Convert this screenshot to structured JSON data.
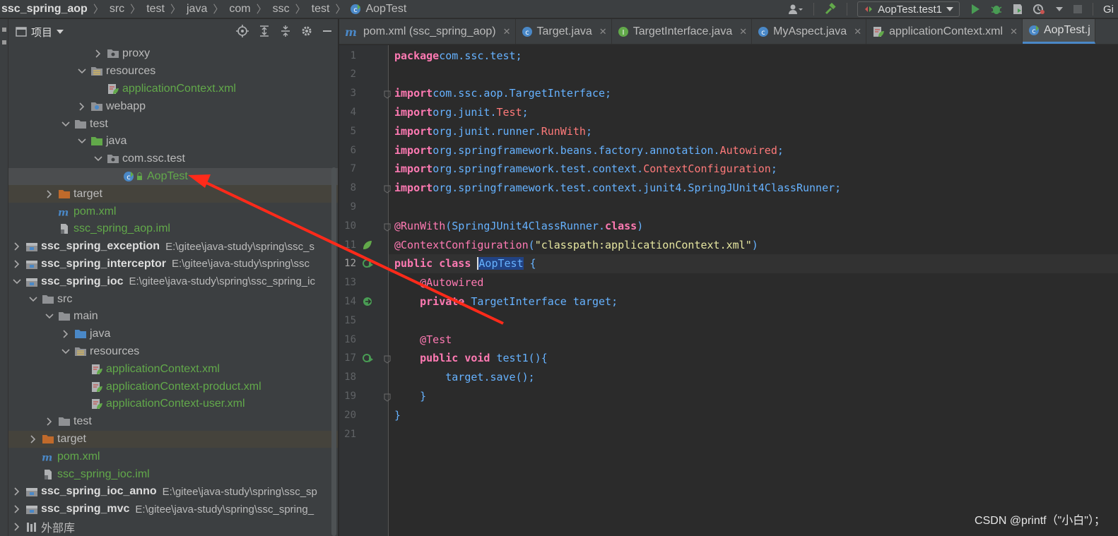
{
  "breadcrumb": {
    "items": [
      "ssc_spring_aop",
      "src",
      "test",
      "java",
      "com",
      "ssc",
      "test",
      "AopTest"
    ]
  },
  "run_config": {
    "label": "AopTest.test1"
  },
  "nav_trailing": "Gi",
  "project_panel": {
    "title": "项目"
  },
  "tree": [
    {
      "label": "proxy",
      "type": "package",
      "indent": 5,
      "arrow": "right"
    },
    {
      "label": "resources",
      "type": "res-folder",
      "indent": 4,
      "arrow": "down"
    },
    {
      "label": "applicationContext.xml",
      "type": "spring-xml",
      "indent": 5,
      "arrow": "",
      "green": true
    },
    {
      "label": "webapp",
      "type": "web-folder",
      "indent": 4,
      "arrow": "right"
    },
    {
      "label": "test",
      "type": "folder",
      "indent": 3,
      "arrow": "down"
    },
    {
      "label": "java",
      "type": "test-src",
      "indent": 4,
      "arrow": "down"
    },
    {
      "label": "com.ssc.test",
      "type": "package",
      "indent": 5,
      "arrow": "down"
    },
    {
      "label": "AopTest",
      "type": "java-class",
      "indent": 6,
      "arrow": "",
      "green": true,
      "selected": true
    },
    {
      "label": "target",
      "type": "target-folder",
      "indent": 2,
      "arrow": "right",
      "tint": true
    },
    {
      "label": "pom.xml",
      "type": "maven",
      "indent": 2,
      "arrow": "",
      "green": true
    },
    {
      "label": "ssc_spring_aop.iml",
      "type": "iml",
      "indent": 2,
      "arrow": "",
      "green": true
    },
    {
      "label": "ssc_spring_exception",
      "type": "module",
      "indent": 0,
      "arrow": "right",
      "bold": true,
      "path": "E:\\gitee\\java-study\\spring\\ssc_s"
    },
    {
      "label": "ssc_spring_interceptor",
      "type": "module",
      "indent": 0,
      "arrow": "right",
      "bold": true,
      "path": "E:\\gitee\\java-study\\spring\\ssc"
    },
    {
      "label": "ssc_spring_ioc",
      "type": "module",
      "indent": 0,
      "arrow": "down",
      "bold": true,
      "path": "E:\\gitee\\java-study\\spring\\ssc_spring_ic"
    },
    {
      "label": "src",
      "type": "folder",
      "indent": 1,
      "arrow": "down"
    },
    {
      "label": "main",
      "type": "folder",
      "indent": 2,
      "arrow": "down"
    },
    {
      "label": "java",
      "type": "src-folder",
      "indent": 3,
      "arrow": "right"
    },
    {
      "label": "resources",
      "type": "res-folder",
      "indent": 3,
      "arrow": "down"
    },
    {
      "label": "applicationContext.xml",
      "type": "spring-xml",
      "indent": 4,
      "arrow": "",
      "green": true
    },
    {
      "label": "applicationContext-product.xml",
      "type": "spring-xml",
      "indent": 4,
      "arrow": "",
      "green": true
    },
    {
      "label": "applicationContext-user.xml",
      "type": "spring-xml",
      "indent": 4,
      "arrow": "",
      "green": true
    },
    {
      "label": "test",
      "type": "folder",
      "indent": 2,
      "arrow": "right"
    },
    {
      "label": "target",
      "type": "target-folder",
      "indent": 1,
      "arrow": "right",
      "tint": true
    },
    {
      "label": "pom.xml",
      "type": "maven",
      "indent": 1,
      "arrow": "",
      "green": true
    },
    {
      "label": "ssc_spring_ioc.iml",
      "type": "iml",
      "indent": 1,
      "arrow": "",
      "green": true
    },
    {
      "label": "ssc_spring_ioc_anno",
      "type": "module",
      "indent": 0,
      "arrow": "right",
      "bold": true,
      "path": "E:\\gitee\\java-study\\spring\\ssc_sp"
    },
    {
      "label": "ssc_spring_mvc",
      "type": "module",
      "indent": 0,
      "arrow": "right",
      "bold": true,
      "path": "E:\\gitee\\java-study\\spring\\ssc_spring_"
    },
    {
      "label": "外部库",
      "type": "libs",
      "indent": 0,
      "arrow": "right"
    }
  ],
  "tabs": [
    {
      "label": "pom.xml (ssc_spring_aop)",
      "icon": "maven-icon"
    },
    {
      "label": "Target.java",
      "icon": "class-icon"
    },
    {
      "label": "TargetInterface.java",
      "icon": "interface-icon"
    },
    {
      "label": "MyAspect.java",
      "icon": "class-icon"
    },
    {
      "label": "applicationContext.xml",
      "icon": "spring-xml-icon"
    },
    {
      "label": "AopTest.j",
      "icon": "test-class-icon",
      "active": true
    }
  ],
  "editor": {
    "current_line": 12,
    "lines": [
      [
        [
          "kw2",
          "package"
        ],
        [
          "",
          "com.ssc.test;"
        ]
      ],
      [],
      [
        [
          "kw2",
          "import"
        ],
        [
          "",
          "com.ssc.aop.TargetInterface;"
        ]
      ],
      [
        [
          "kw2",
          "import"
        ],
        [
          "",
          "org.junit."
        ],
        [
          "ty",
          "Test"
        ],
        [
          "",
          ";"
        ]
      ],
      [
        [
          "kw2",
          "import"
        ],
        [
          "",
          "org.junit.runner."
        ],
        [
          "ty",
          "RunWith"
        ],
        [
          "",
          ";"
        ]
      ],
      [
        [
          "kw2",
          "import"
        ],
        [
          "",
          "org.springframework.beans.factory.annotation."
        ],
        [
          "ty",
          "Autowired"
        ],
        [
          "",
          ";"
        ]
      ],
      [
        [
          "kw2",
          "import"
        ],
        [
          "",
          "org.springframework.test.context."
        ],
        [
          "ty",
          "ContextConfiguration"
        ],
        [
          "",
          ";"
        ]
      ],
      [
        [
          "kw2",
          "import"
        ],
        [
          "",
          "org.springframework.test.context.junit4.SpringJUnit4ClassRunner;"
        ]
      ],
      [],
      [
        [
          "ann2",
          "@RunWith"
        ],
        [
          "",
          "(SpringJUnit4ClassRunner."
        ],
        [
          "kw2",
          "class"
        ],
        [
          "",
          ")"
        ]
      ],
      [
        [
          "ann2",
          "@ContextConfiguration"
        ],
        [
          "",
          "("
        ],
        [
          "str2",
          "\"classpath:applicationContext.xml\""
        ],
        [
          "",
          ")"
        ]
      ],
      [
        [
          "kw2",
          "public class"
        ],
        [
          "",
          " "
        ],
        [
          "selc",
          "AopTest"
        ],
        [
          "",
          " {"
        ]
      ],
      [
        [
          "",
          "    "
        ],
        [
          "ann2",
          "@Autowired"
        ]
      ],
      [
        [
          "",
          "    "
        ],
        [
          "kw2",
          "private"
        ],
        [
          "",
          " TargetInterface "
        ],
        [
          "call",
          "target"
        ],
        [
          "",
          ";"
        ]
      ],
      [],
      [
        [
          "",
          "    "
        ],
        [
          "ann2",
          "@Test"
        ]
      ],
      [
        [
          "",
          "    "
        ],
        [
          "kw2",
          "public void"
        ],
        [
          "",
          " "
        ],
        [
          "call",
          "test1"
        ],
        [
          "",
          "(){"
        ]
      ],
      [
        [
          "",
          "        "
        ],
        [
          "call",
          "target"
        ],
        [
          "",
          ".save();"
        ]
      ],
      [
        [
          "",
          "    }"
        ]
      ],
      [
        [
          "",
          "}"
        ]
      ],
      []
    ]
  },
  "watermark": "CSDN @printf（\"小白\"）；",
  "colors": {
    "accent": "#4a88c7",
    "annotation_arrow": "#ff2a1a",
    "green_file": "#62a94a"
  }
}
